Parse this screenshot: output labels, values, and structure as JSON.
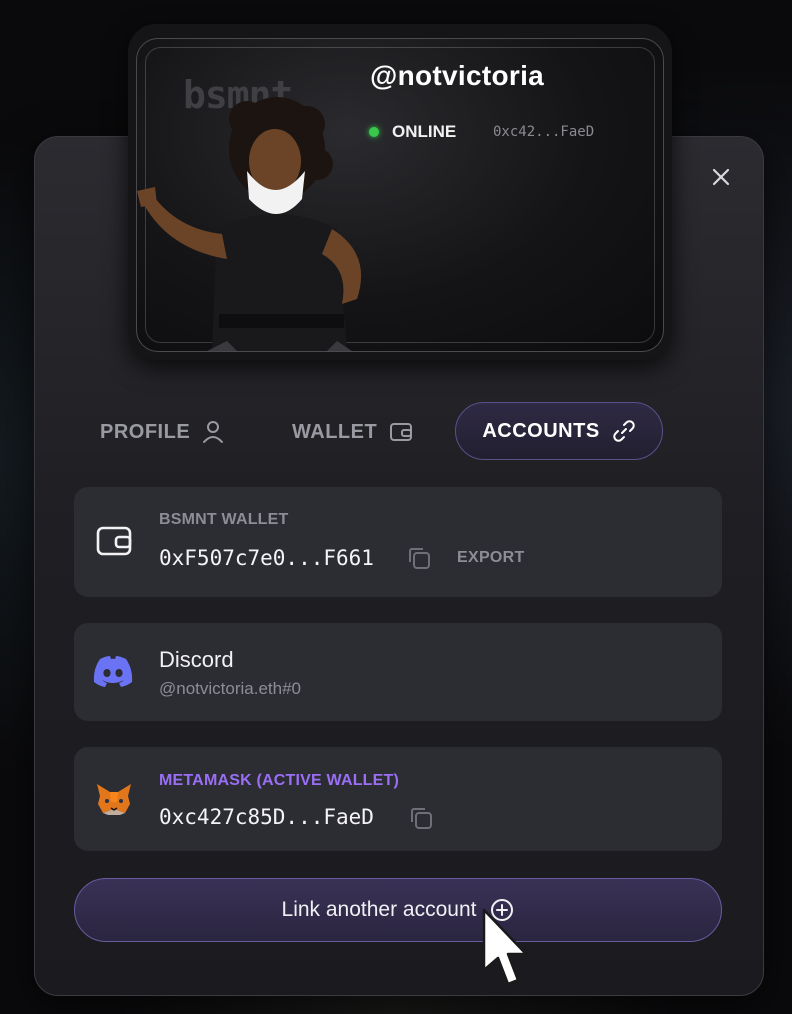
{
  "profile": {
    "brand": "bsmnt",
    "username": "@notvictoria",
    "status": "ONLINE",
    "short_address": "0xc42...FaeD"
  },
  "tabs": [
    {
      "label": "PROFILE",
      "icon": "user-icon",
      "active": false
    },
    {
      "label": "WALLET",
      "icon": "wallet-icon",
      "active": false
    },
    {
      "label": "ACCOUNTS",
      "icon": "link-icon",
      "active": true
    }
  ],
  "accounts": [
    {
      "label": "BSMNT WALLET",
      "address": "0xF507c7e0...F661",
      "action": "EXPORT",
      "icon": "wallet-icon"
    },
    {
      "name": "Discord",
      "handle": "@notvictoria.eth#0",
      "icon": "discord-icon"
    },
    {
      "label": "METAMASK (ACTIVE WALLET)",
      "address": "0xc427c85D...FaeD",
      "icon": "metamask-fox-icon"
    }
  ],
  "link_button": {
    "label": "Link another account",
    "icon": "plus-circle-icon"
  },
  "colors": {
    "accent_purple": "#8c62f0",
    "online_green": "#38c84c",
    "discord_blurple": "#5865f2",
    "panel_bg": "#1f1f23",
    "card_bg": "#2c2c33"
  }
}
